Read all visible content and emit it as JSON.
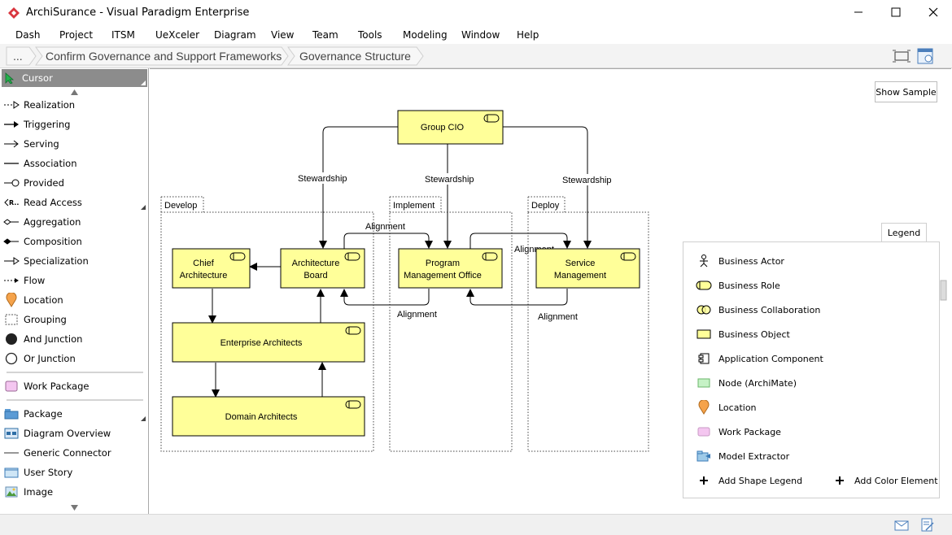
{
  "window": {
    "title": "ArchiSurance - Visual Paradigm Enterprise",
    "minimize": "—",
    "maximize": "☐",
    "close": "✕"
  },
  "menu": [
    "Dash",
    "Project",
    "ITSM",
    "UeXceler",
    "Diagram",
    "View",
    "Team",
    "Tools",
    "Modeling",
    "Window",
    "Help"
  ],
  "breadcrumb": {
    "more": "...",
    "items": [
      "Confirm Governance and Support Frameworks",
      "Governance Structure"
    ]
  },
  "palette": {
    "items": [
      {
        "label": "Cursor",
        "icon": "cursor-icon"
      },
      {
        "label": "Realization",
        "icon": "realization-icon"
      },
      {
        "label": "Triggering",
        "icon": "triggering-icon"
      },
      {
        "label": "Serving",
        "icon": "serving-icon"
      },
      {
        "label": "Association",
        "icon": "association-icon"
      },
      {
        "label": "Provided",
        "icon": "provided-icon"
      },
      {
        "label": "Read Access",
        "icon": "read-access-icon"
      },
      {
        "label": "Aggregation",
        "icon": "aggregation-icon"
      },
      {
        "label": "Composition",
        "icon": "composition-icon"
      },
      {
        "label": "Specialization",
        "icon": "specialization-icon"
      },
      {
        "label": "Flow",
        "icon": "flow-icon"
      },
      {
        "label": "Location",
        "icon": "location-icon"
      },
      {
        "label": "Grouping",
        "icon": "grouping-icon"
      },
      {
        "label": "And Junction",
        "icon": "and-junction-icon"
      },
      {
        "label": "Or Junction",
        "icon": "or-junction-icon"
      },
      {
        "label": "Work Package",
        "icon": "work-package-icon"
      },
      {
        "label": "Package",
        "icon": "package-icon"
      },
      {
        "label": "Diagram Overview",
        "icon": "diagram-overview-icon"
      },
      {
        "label": "Generic Connector",
        "icon": "generic-connector-icon"
      },
      {
        "label": "User Story",
        "icon": "user-story-icon"
      },
      {
        "label": "Image",
        "icon": "image-icon"
      }
    ]
  },
  "diagram": {
    "show_sample": "Show Sample",
    "groups": {
      "develop": "Develop",
      "implement": "Implement",
      "deploy": "Deploy"
    },
    "nodes": {
      "group_cio": "Group CIO",
      "chief_architecture": [
        "Chief",
        "Architecture"
      ],
      "architecture_board": [
        "Architecture",
        "Board"
      ],
      "program_management_office": [
        "Program",
        "Management Office"
      ],
      "service_management": [
        "Service",
        "Management"
      ],
      "enterprise_architects": "Enterprise Architects",
      "domain_architects": "Domain Architects"
    },
    "edge_labels": {
      "stewardship": "Stewardship",
      "alignment": "Alignment"
    }
  },
  "legend": {
    "tab": "Legend",
    "items": [
      {
        "label": "Business Actor",
        "icon": "business-actor-icon"
      },
      {
        "label": "Business Role",
        "icon": "business-role-icon"
      },
      {
        "label": "Business Collaboration",
        "icon": "business-collaboration-icon"
      },
      {
        "label": "Business Object",
        "icon": "business-object-icon"
      },
      {
        "label": "Application Component",
        "icon": "application-component-icon"
      },
      {
        "label": "Node (ArchiMate)",
        "icon": "node-icon"
      },
      {
        "label": "Location",
        "icon": "location-icon"
      },
      {
        "label": "Work Package",
        "icon": "work-package-icon"
      },
      {
        "label": "Model Extractor",
        "icon": "model-extractor-icon"
      }
    ],
    "add_shape": "Add Shape Legend",
    "add_color": "Add Color Element"
  },
  "colors": {
    "node_fill": "#ffff99",
    "palette_selected": "#8c8c8c",
    "accent_red": "#d9363e"
  }
}
